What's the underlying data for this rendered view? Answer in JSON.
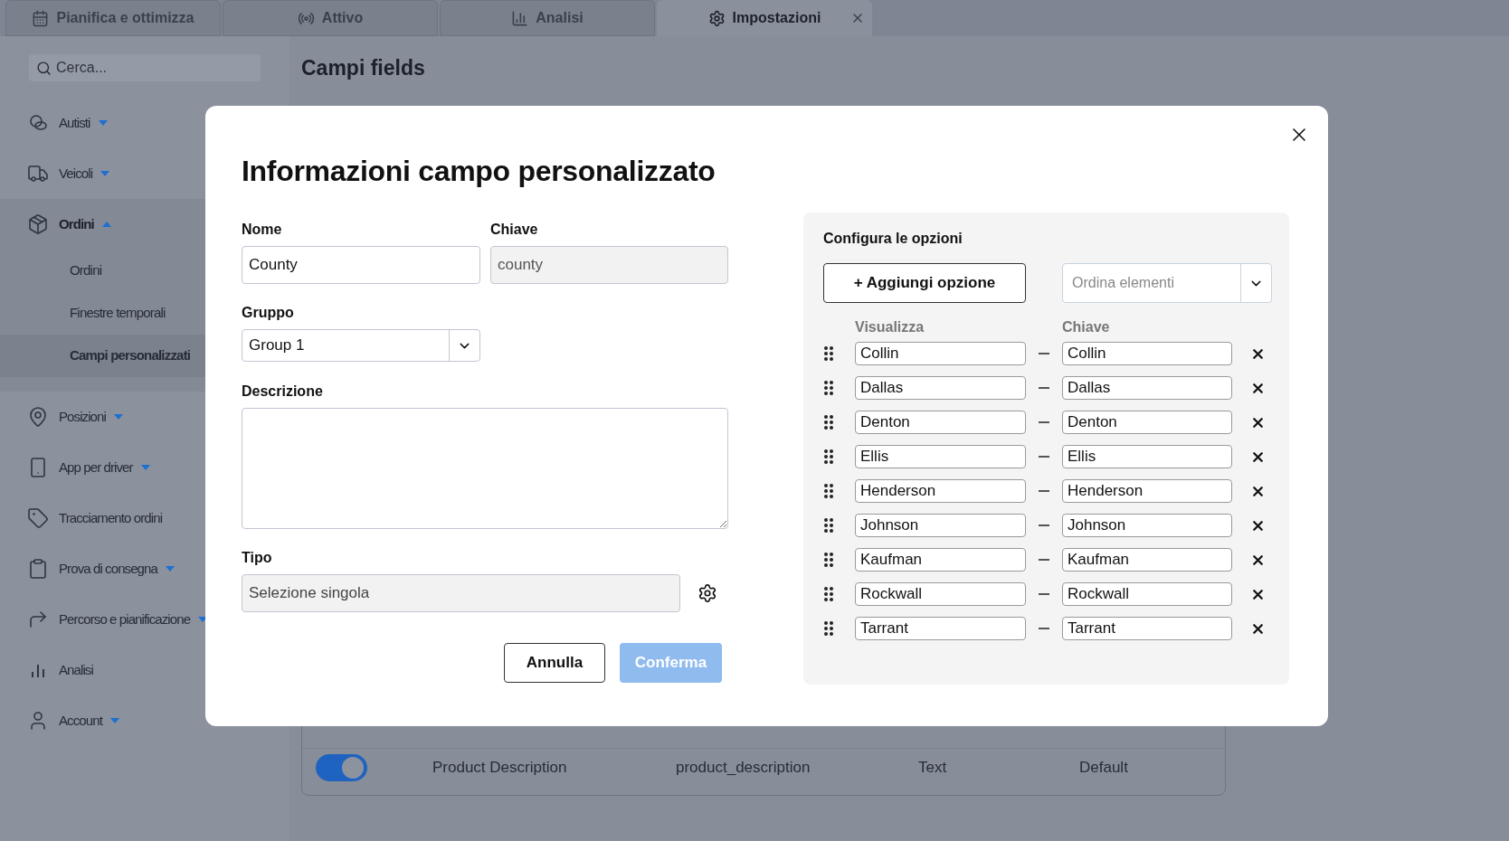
{
  "tabs": [
    {
      "label": "Pianifica e ottimizza",
      "selected": false,
      "closable": false
    },
    {
      "label": "Attivo",
      "selected": false,
      "closable": false
    },
    {
      "label": "Analisi",
      "selected": false,
      "closable": false
    },
    {
      "label": "Impostazioni",
      "selected": true,
      "closable": true
    }
  ],
  "search": {
    "placeholder": "Cerca..."
  },
  "sidebar": {
    "items": [
      {
        "label": "Autisti",
        "expandable": true,
        "expanded": false
      },
      {
        "label": "Veicoli",
        "expandable": true,
        "expanded": false
      },
      {
        "label": "Ordini",
        "expandable": true,
        "expanded": true,
        "children": [
          {
            "label": "Ordini",
            "selected": false
          },
          {
            "label": "Finestre temporali",
            "selected": false
          },
          {
            "label": "Campi personalizzati",
            "selected": true
          }
        ]
      },
      {
        "label": "Posizioni",
        "expandable": true,
        "expanded": false
      },
      {
        "label": "App per driver",
        "expandable": true,
        "expanded": false
      },
      {
        "label": "Tracciamento ordini",
        "expandable": false,
        "expanded": false
      },
      {
        "label": "Prova di consegna",
        "expandable": true,
        "expanded": false
      },
      {
        "label": "Percorso e pianificazione",
        "expandable": true,
        "expanded": false
      },
      {
        "label": "Analisi",
        "expandable": false,
        "expanded": false
      },
      {
        "label": "Account",
        "expandable": true,
        "expanded": false
      }
    ]
  },
  "page_title": "Campi fields",
  "table": {
    "rows": [
      {
        "enabled": true,
        "name": "Product Description",
        "key": "product_description",
        "type": "Text",
        "source": "Default"
      }
    ]
  },
  "dialog": {
    "title": "Informazioni campo personalizzato",
    "name": {
      "label": "Nome",
      "value": "County"
    },
    "key": {
      "label": "Chiave",
      "value": "county",
      "disabled": true
    },
    "group": {
      "label": "Gruppo",
      "value": "Group 1"
    },
    "description": {
      "label": "Descrizione"
    },
    "type": {
      "label": "Tipo",
      "value": "Selezione singola",
      "disabled": true
    },
    "cancel": "Annulla",
    "confirm": {
      "label": "Conferma",
      "disabled": true
    },
    "options": {
      "title": "Configura le opzioni",
      "add_button": "+ Aggiungi opzione",
      "sort_placeholder": "Ordina elementi",
      "display_header": "Visualizza",
      "key_header": "Chiave",
      "items": [
        {
          "display": "Collin",
          "key": "Collin"
        },
        {
          "display": "Dallas",
          "key": "Dallas"
        },
        {
          "display": "Denton",
          "key": "Denton"
        },
        {
          "display": "Ellis",
          "key": "Ellis"
        },
        {
          "display": "Henderson",
          "key": "Henderson"
        },
        {
          "display": "Johnson",
          "key": "Johnson"
        },
        {
          "display": "Kaufman",
          "key": "Kaufman"
        },
        {
          "display": "Rockwall",
          "key": "Rockwall"
        },
        {
          "display": "Tarrant",
          "key": "Tarrant"
        }
      ]
    }
  }
}
